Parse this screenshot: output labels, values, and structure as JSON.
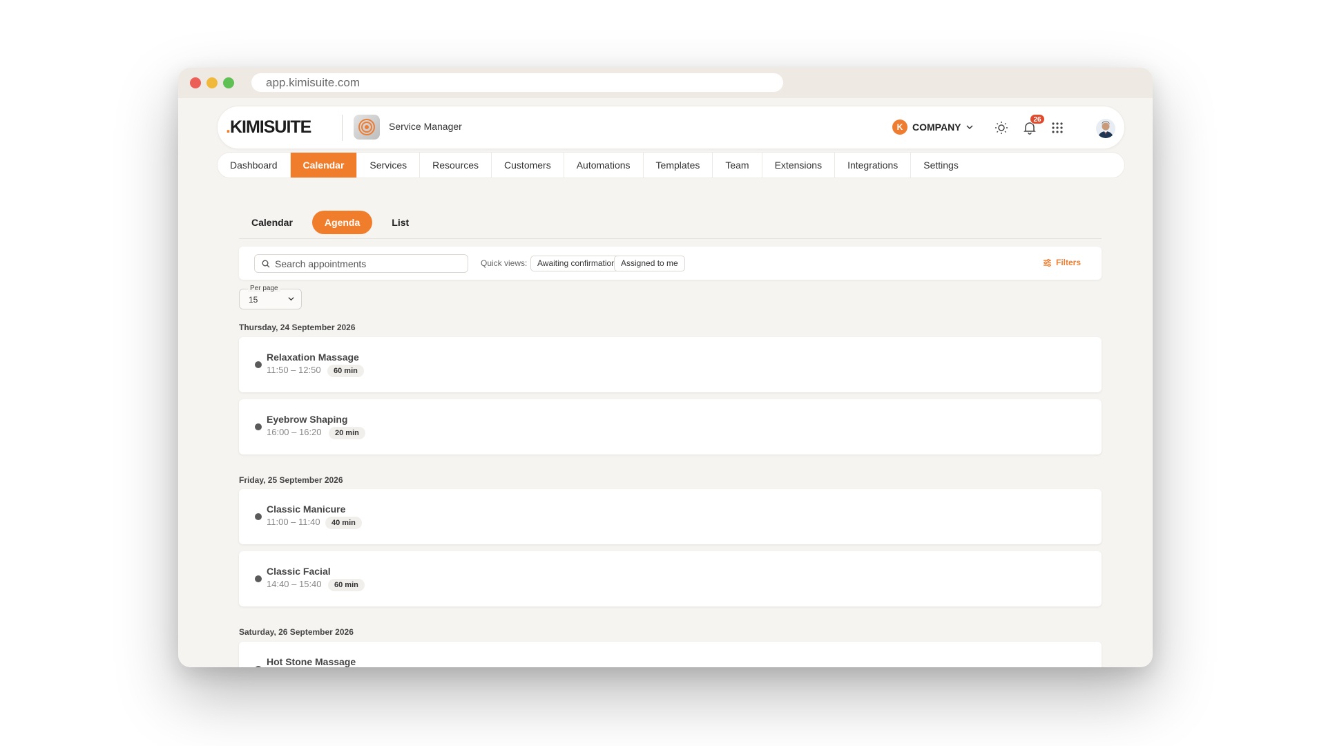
{
  "browser": {
    "url": "app.kimisuite.com"
  },
  "header": {
    "brand_prefix": ".",
    "brand_name": "KIMISUITE",
    "app_name": "Service Manager",
    "company_badge": "K",
    "company_label": "COMPANY",
    "notification_count": "26"
  },
  "nav": {
    "items": [
      {
        "label": "Dashboard",
        "active": false
      },
      {
        "label": "Calendar",
        "active": true
      },
      {
        "label": "Services",
        "active": false
      },
      {
        "label": "Resources",
        "active": false
      },
      {
        "label": "Customers",
        "active": false
      },
      {
        "label": "Automations",
        "active": false
      },
      {
        "label": "Templates",
        "active": false
      },
      {
        "label": "Team",
        "active": false
      },
      {
        "label": "Extensions",
        "active": false
      },
      {
        "label": "Integrations",
        "active": false
      },
      {
        "label": "Settings",
        "active": false
      }
    ]
  },
  "view_tabs": [
    {
      "label": "Calendar",
      "active": false
    },
    {
      "label": "Agenda",
      "active": true
    },
    {
      "label": "List",
      "active": false
    }
  ],
  "search": {
    "placeholder": "Search appointments",
    "quick_views_label": "Quick views:",
    "quick_views": [
      "Awaiting confirmation",
      "Assigned to me"
    ],
    "filters_label": "Filters"
  },
  "per_page": {
    "label": "Per page",
    "value": "15"
  },
  "days": [
    {
      "date": "Thursday, 24 September 2026",
      "appointments": [
        {
          "title": "Relaxation Massage",
          "time": "11:50 – 12:50",
          "duration": "60 min"
        },
        {
          "title": "Eyebrow Shaping",
          "time": "16:00 – 16:20",
          "duration": "20 min"
        }
      ]
    },
    {
      "date": "Friday, 25 September 2026",
      "appointments": [
        {
          "title": "Classic Manicure",
          "time": "11:00 – 11:40",
          "duration": "40 min"
        },
        {
          "title": "Classic Facial",
          "time": "14:40 – 15:40",
          "duration": "60 min"
        }
      ]
    },
    {
      "date": "Saturday, 26 September 2026",
      "appointments": [
        {
          "title": "Hot Stone Massage",
          "time": "",
          "duration": ""
        }
      ]
    }
  ],
  "colors": {
    "accent": "#f07d2c",
    "page_bg": "#f6f4f1",
    "notification": "#e04a2d"
  }
}
